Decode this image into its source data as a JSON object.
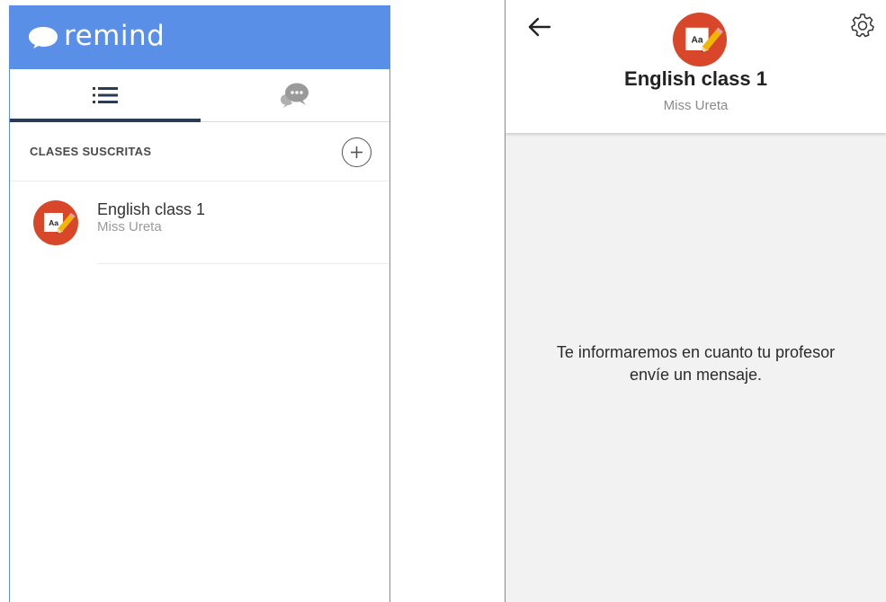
{
  "list_screen": {
    "app_name": "remind",
    "brand_color": "#5a8fe8",
    "tabs": [
      {
        "icon": "list-icon",
        "active": true
      },
      {
        "icon": "chat-bubbles-icon",
        "active": false
      }
    ],
    "section_title": "CLASES SUSCRITAS",
    "add_icon": "plus-circle-icon",
    "classes": [
      {
        "name": "English class 1",
        "teacher": "Miss Ureta",
        "icon": "class-avatar-icon"
      }
    ]
  },
  "detail_screen": {
    "back_icon": "arrow-left-icon",
    "settings_icon": "gear-icon",
    "class_name": "English class 1",
    "teacher": "Miss Ureta",
    "empty_message": "Te informaremos en cuanto tu profesor envíe un mensaje."
  }
}
